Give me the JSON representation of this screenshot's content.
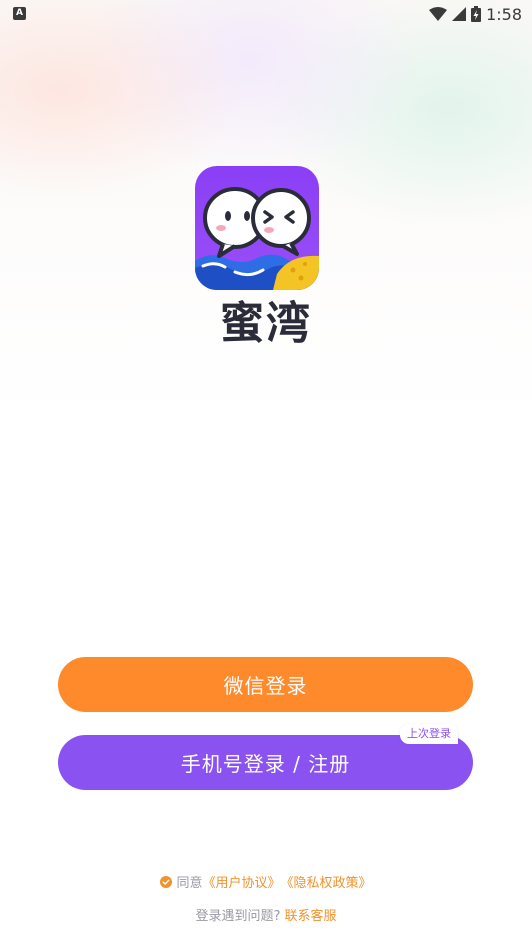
{
  "status_bar": {
    "notification_icon": "A",
    "time": "1:58",
    "icons": [
      "wifi-icon",
      "signal-icon",
      "battery-charging-icon"
    ]
  },
  "app": {
    "name": "蜜湾",
    "logo_icon": "chat-bubbles-logo"
  },
  "buttons": {
    "wechat_login": "微信登录",
    "phone_login": "手机号登录 / 注册",
    "last_login_badge": "上次登录"
  },
  "agreement": {
    "prefix": "同意",
    "user_agreement": "《用户协议》",
    "privacy_policy": "《隐私权政策》"
  },
  "help": {
    "question": "登录遇到问题?",
    "contact": "联系客服"
  },
  "colors": {
    "wechat_button": "#fe8a2c",
    "phone_button": "#8a52f1",
    "link": "#f0922e",
    "muted_text": "#9a9aa4"
  }
}
